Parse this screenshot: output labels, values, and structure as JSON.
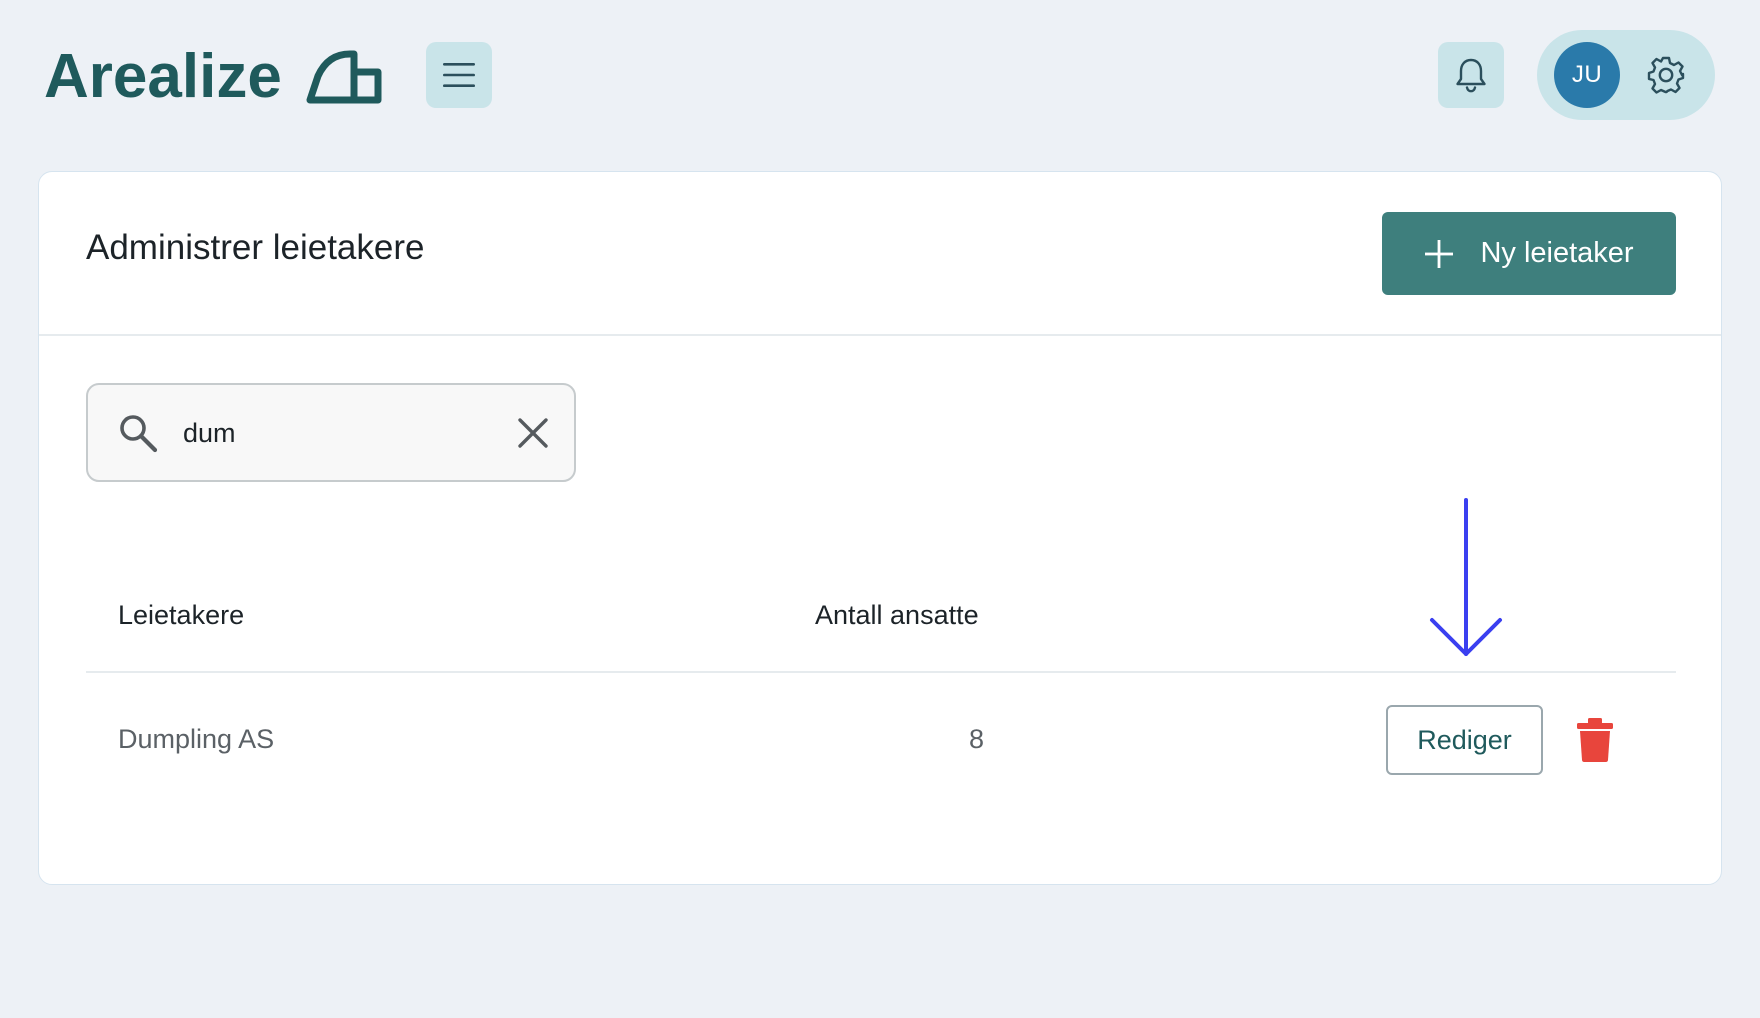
{
  "header": {
    "brand": "Arealize",
    "logo_mark_icon": "house-outline-icon",
    "menu_icon": "hamburger-menu-icon",
    "bell_icon": "bell-icon",
    "user_initials": "JU",
    "settings_icon": "gear-icon"
  },
  "page": {
    "title": "Administrer leietakere",
    "new_button_label": "Ny leietaker",
    "new_button_icon": "plus-icon"
  },
  "search": {
    "value": "dum",
    "icon": "search-icon",
    "clear_icon": "close-icon"
  },
  "table": {
    "columns": [
      "Leietakere",
      "Antall ansatte"
    ],
    "rows": [
      {
        "name": "Dumpling AS",
        "employees": "8",
        "edit_label": "Rediger",
        "delete_icon": "trash-icon"
      }
    ]
  },
  "colors": {
    "background": "#edf1f6",
    "brand": "#1f5a5c",
    "primary_button": "#3e7f7d",
    "icon_button_bg": "#c9e4e9",
    "avatar": "#2a7aaa",
    "danger": "#e8453c",
    "annotation_arrow": "#3a3ff0"
  }
}
